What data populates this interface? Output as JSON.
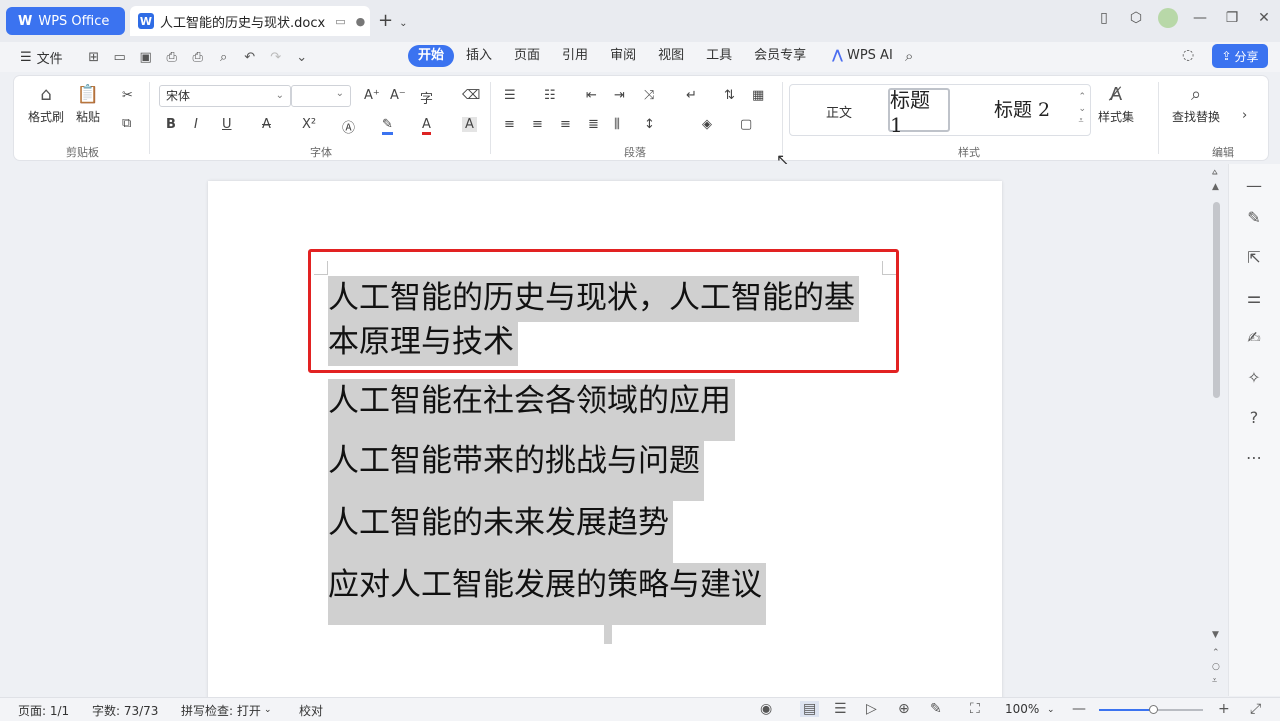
{
  "titlebar": {
    "app_tab": "WPS Office",
    "app_logo": "W",
    "doc_tab_title": "人工智能的历史与现状.docx",
    "doc_icon": "W",
    "new_tab": "+"
  },
  "menubar": {
    "file_label": "文件",
    "items": [
      "开始",
      "插入",
      "页面",
      "引用",
      "审阅",
      "视图",
      "工具",
      "会员专享"
    ],
    "active_item": "开始",
    "wps_ai_label": "WPS AI",
    "share_label": "分享"
  },
  "ribbon": {
    "clipboard": {
      "format_painter": "格式刷",
      "paste": "粘贴",
      "group_label": "剪贴板"
    },
    "font": {
      "font_name": "宋体",
      "font_size": "",
      "group_label": "字体"
    },
    "paragraph": {
      "group_label": "段落"
    },
    "styles": {
      "normal": "正文",
      "heading1": "标题 1",
      "heading2": "标题 2",
      "style_set": "样式集",
      "group_label": "样式"
    },
    "editing": {
      "find_replace": "查找替换",
      "group_label": "编辑"
    }
  },
  "document": {
    "lines": [
      "人工智能的历史与现状，人工智能的基",
      "本原理与技术",
      "人工智能在社会各领域的应用",
      "人工智能带来的挑战与问题",
      "人工智能的未来发展趋势",
      "应对人工智能发展的策略与建议"
    ],
    "highlight_color": "#e22222",
    "selection_color": "#d0d0d0"
  },
  "statusbar": {
    "page": "页面: 1/1",
    "word_count": "字数: 73/73",
    "spell_check": "拼写检查: 打开",
    "proofread": "校对",
    "zoom": "100%"
  },
  "colors": {
    "accent": "#3b73f0"
  }
}
